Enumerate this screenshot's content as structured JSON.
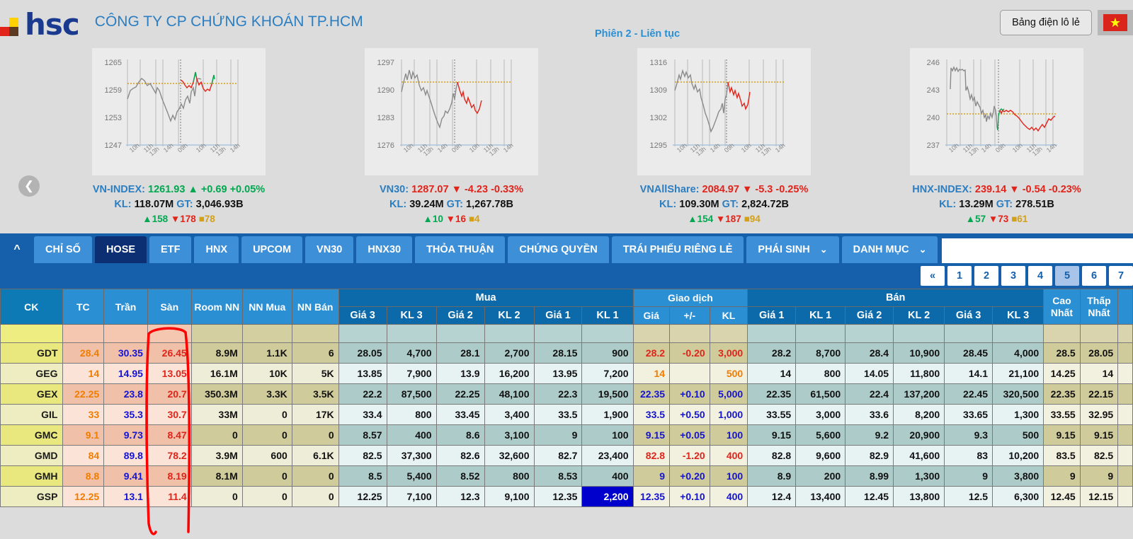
{
  "header": {
    "logo_text": "hsc",
    "company_name": "CÔNG TY CP CHỨNG KHOÁN TP.HCM",
    "session_label": "Phiên 2 - Liên tục",
    "odd_lot_button": "Bảng điện lô lẻ",
    "flag_star": "★"
  },
  "nav": {
    "prev_arrow": "❮"
  },
  "indices": [
    {
      "name": "VN-INDEX",
      "value": "1261.93",
      "arrow": "▲",
      "change": "+0.69",
      "percent": "+0.05%",
      "direction": "up",
      "volume_label": "KL:",
      "volume": "118.07M",
      "value_label": "GT:",
      "traded_value": "3,046.93B",
      "advances": "158",
      "declines": "178",
      "unchanged": "78",
      "y_ticks": [
        "1265",
        "1259",
        "1253",
        "1247"
      ],
      "x_ticks": [
        "10h",
        "11h",
        "13h",
        "14h",
        "09h",
        "10h",
        "11h",
        "13h",
        "14h"
      ]
    },
    {
      "name": "VN30",
      "value": "1287.07",
      "arrow": "▼",
      "change": "-4.23",
      "percent": "-0.33%",
      "direction": "down",
      "volume_label": "KL:",
      "volume": "39.24M",
      "value_label": "GT:",
      "traded_value": "1,267.78B",
      "advances": "10",
      "declines": "16",
      "unchanged": "4",
      "y_ticks": [
        "1297",
        "1290",
        "1283",
        "1276"
      ],
      "x_ticks": [
        "10h",
        "11h",
        "13h",
        "14h",
        "09h",
        "10h",
        "11h",
        "13h",
        "14h"
      ]
    },
    {
      "name": "VNAllShare",
      "value": "2084.97",
      "arrow": "▼",
      "change": "-5.3",
      "percent": "-0.25%",
      "direction": "down",
      "volume_label": "KL:",
      "volume": "109.30M",
      "value_label": "GT:",
      "traded_value": "2,824.72B",
      "advances": "154",
      "declines": "187",
      "unchanged": "94",
      "y_ticks": [
        "1316",
        "1309",
        "1302",
        "1295"
      ],
      "x_ticks": [
        "10h",
        "11h",
        "13h",
        "14h",
        "09h",
        "10h",
        "11h",
        "13h",
        "14h"
      ]
    },
    {
      "name": "HNX-INDEX",
      "value": "239.14",
      "arrow": "▼",
      "change": "-0.54",
      "percent": "-0.23%",
      "direction": "down",
      "volume_label": "KL:",
      "volume": "13.29M",
      "value_label": "GT:",
      "traded_value": "278.51B",
      "advances": "57",
      "declines": "73",
      "unchanged": "61",
      "y_ticks": [
        "246",
        "243",
        "240",
        "237"
      ],
      "x_ticks": [
        "10h",
        "11h",
        "13h",
        "14h",
        "09h",
        "10h",
        "11h",
        "13h",
        "14h"
      ]
    }
  ],
  "tabs": [
    {
      "label": "CHỈ SỐ",
      "active": false,
      "caret": false
    },
    {
      "label": "HOSE",
      "active": true,
      "caret": false
    },
    {
      "label": "ETF",
      "active": false,
      "caret": false
    },
    {
      "label": "HNX",
      "active": false,
      "caret": false
    },
    {
      "label": "UPCOM",
      "active": false,
      "caret": false
    },
    {
      "label": "VN30",
      "active": false,
      "caret": false
    },
    {
      "label": "HNX30",
      "active": false,
      "caret": false
    },
    {
      "label": "THỎA THUẬN",
      "active": false,
      "caret": false
    },
    {
      "label": "CHỨNG QUYỀN",
      "active": false,
      "caret": false
    },
    {
      "label": "TRÁI PHIẾU RIÊNG LẺ",
      "active": false,
      "caret": false
    },
    {
      "label": "PHÁI SINH",
      "active": false,
      "caret": true
    },
    {
      "label": "DANH MỤC",
      "active": false,
      "caret": true
    }
  ],
  "search": {
    "value": "",
    "placeholder": ""
  },
  "pagination": {
    "prev": "«",
    "pages": [
      "1",
      "2",
      "3",
      "4",
      "5",
      "6",
      "7"
    ],
    "active": "5"
  },
  "table": {
    "group_headers": {
      "mua": "Mua",
      "giao_dich": "Giao dịch",
      "ban": "Bán"
    },
    "columns": [
      "CK",
      "TC",
      "Trần",
      "Sàn",
      "Room NN",
      "NN Mua",
      "NN Bán",
      "Giá 3",
      "KL 3",
      "Giá 2",
      "KL 2",
      "Giá 1",
      "KL 1",
      "Giá",
      "+/-",
      "KL",
      "Giá 1",
      "KL 1",
      "Giá 2",
      "KL 2",
      "Giá 3",
      "KL 3",
      "Cao Nhất",
      "Thấp Nhất"
    ],
    "col_cao_nhat_l1": "Cao",
    "col_cao_nhat_l2": "Nhất",
    "col_thap_nhat_l1": "Thấp",
    "col_thap_nhat_l2": "Nhất",
    "rows": [
      {
        "ck": "GDT",
        "tc": "28.4",
        "tran": "30.35",
        "san": "26.45",
        "room_nn": "8.9M",
        "nn_mua": "1.1K",
        "nn_ban": "6",
        "b_gia3": "28.05",
        "b_kl3": "4,700",
        "b_gia2": "28.1",
        "b_kl2": "2,700",
        "b_gia1": "28.15",
        "b_kl1": "900",
        "gd_gia": "28.2",
        "gd_chg": "-0.20",
        "gd_kl": "3,000",
        "gd_dir": "down",
        "s_gia1": "28.2",
        "s_kl1": "8,700",
        "s_gia2": "28.4",
        "s_kl2": "10,900",
        "s_gia3": "28.45",
        "s_kl3": "4,000",
        "cao": "28.5",
        "thap": "28.05",
        "highlight_kl1": false
      },
      {
        "ck": "GEG",
        "tc": "14",
        "tran": "14.95",
        "san": "13.05",
        "room_nn": "16.1M",
        "nn_mua": "10K",
        "nn_ban": "5K",
        "b_gia3": "13.85",
        "b_kl3": "7,900",
        "b_gia2": "13.9",
        "b_kl2": "16,200",
        "b_gia1": "13.95",
        "b_kl1": "7,200",
        "gd_gia": "14",
        "gd_chg": "",
        "gd_kl": "500",
        "gd_dir": "flat",
        "s_gia1": "14",
        "s_kl1": "800",
        "s_gia2": "14.05",
        "s_kl2": "11,800",
        "s_gia3": "14.1",
        "s_kl3": "21,100",
        "cao": "14.25",
        "thap": "14",
        "highlight_kl1": false
      },
      {
        "ck": "GEX",
        "tc": "22.25",
        "tran": "23.8",
        "san": "20.7",
        "room_nn": "350.3M",
        "nn_mua": "3.3K",
        "nn_ban": "3.5K",
        "b_gia3": "22.2",
        "b_kl3": "87,500",
        "b_gia2": "22.25",
        "b_kl2": "48,100",
        "b_gia1": "22.3",
        "b_kl1": "19,500",
        "gd_gia": "22.35",
        "gd_chg": "+0.10",
        "gd_kl": "5,000",
        "gd_dir": "up",
        "s_gia1": "22.35",
        "s_kl1": "61,500",
        "s_gia2": "22.4",
        "s_kl2": "137,200",
        "s_gia3": "22.45",
        "s_kl3": "320,500",
        "cao": "22.35",
        "thap": "22.15",
        "highlight_kl1": false
      },
      {
        "ck": "GIL",
        "tc": "33",
        "tran": "35.3",
        "san": "30.7",
        "room_nn": "33M",
        "nn_mua": "0",
        "nn_ban": "17K",
        "b_gia3": "33.4",
        "b_kl3": "800",
        "b_gia2": "33.45",
        "b_kl2": "3,400",
        "b_gia1": "33.5",
        "b_kl1": "1,900",
        "gd_gia": "33.5",
        "gd_chg": "+0.50",
        "gd_kl": "1,000",
        "gd_dir": "up",
        "s_gia1": "33.55",
        "s_kl1": "3,000",
        "s_gia2": "33.6",
        "s_kl2": "8,200",
        "s_gia3": "33.65",
        "s_kl3": "1,300",
        "cao": "33.55",
        "thap": "32.95",
        "highlight_kl1": false
      },
      {
        "ck": "GMC",
        "tc": "9.1",
        "tran": "9.73",
        "san": "8.47",
        "room_nn": "0",
        "nn_mua": "0",
        "nn_ban": "0",
        "b_gia3": "8.57",
        "b_kl3": "400",
        "b_gia2": "8.6",
        "b_kl2": "3,100",
        "b_gia1": "9",
        "b_kl1": "100",
        "gd_gia": "9.15",
        "gd_chg": "+0.05",
        "gd_kl": "100",
        "gd_dir": "up",
        "s_gia1": "9.15",
        "s_kl1": "5,600",
        "s_gia2": "9.2",
        "s_kl2": "20,900",
        "s_gia3": "9.3",
        "s_kl3": "500",
        "cao": "9.15",
        "thap": "9.15",
        "highlight_kl1": false
      },
      {
        "ck": "GMD",
        "tc": "84",
        "tran": "89.8",
        "san": "78.2",
        "room_nn": "3.9M",
        "nn_mua": "600",
        "nn_ban": "6.1K",
        "b_gia3": "82.5",
        "b_kl3": "37,300",
        "b_gia2": "82.6",
        "b_kl2": "32,600",
        "b_gia1": "82.7",
        "b_kl1": "23,400",
        "gd_gia": "82.8",
        "gd_chg": "-1.20",
        "gd_kl": "400",
        "gd_dir": "down",
        "s_gia1": "82.8",
        "s_kl1": "9,600",
        "s_gia2": "82.9",
        "s_kl2": "41,600",
        "s_gia3": "83",
        "s_kl3": "10,200",
        "cao": "83.5",
        "thap": "82.5",
        "highlight_kl1": false
      },
      {
        "ck": "GMH",
        "tc": "8.8",
        "tran": "9.41",
        "san": "8.19",
        "room_nn": "8.1M",
        "nn_mua": "0",
        "nn_ban": "0",
        "b_gia3": "8.5",
        "b_kl3": "5,400",
        "b_gia2": "8.52",
        "b_kl2": "800",
        "b_gia1": "8.53",
        "b_kl1": "400",
        "gd_gia": "9",
        "gd_chg": "+0.20",
        "gd_kl": "100",
        "gd_dir": "up",
        "s_gia1": "8.9",
        "s_kl1": "200",
        "s_gia2": "8.99",
        "s_kl2": "1,300",
        "s_gia3": "9",
        "s_kl3": "3,800",
        "cao": "9",
        "thap": "9",
        "highlight_kl1": false
      },
      {
        "ck": "GSP",
        "tc": "12.25",
        "tran": "13.1",
        "san": "11.4",
        "room_nn": "0",
        "nn_mua": "0",
        "nn_ban": "0",
        "b_gia3": "12.25",
        "b_kl3": "7,100",
        "b_gia2": "12.3",
        "b_kl2": "9,100",
        "b_gia1": "12.35",
        "b_kl1": "2,200",
        "gd_gia": "12.35",
        "gd_chg": "+0.10",
        "gd_kl": "400",
        "gd_dir": "up",
        "s_gia1": "12.4",
        "s_kl1": "13,400",
        "s_gia2": "12.45",
        "s_kl2": "13,800",
        "s_gia3": "12.5",
        "s_kl3": "6,300",
        "cao": "12.45",
        "thap": "12.15",
        "highlight_kl1": true
      }
    ]
  },
  "annotation": {
    "color": "#ff0000",
    "target_column": "Sàn"
  },
  "colors": {
    "brand_blue": "#1660ab",
    "tab_blue": "#3d8fd8",
    "tab_active": "#0b2f72",
    "up_green": "#00a84f",
    "down_red": "#e2231a",
    "ref_orange": "#f07d00",
    "ceiling_purple": "#1414d2"
  }
}
